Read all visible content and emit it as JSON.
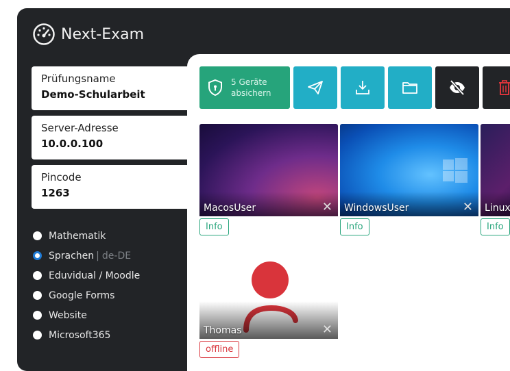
{
  "app": {
    "title": "Next-Exam"
  },
  "fields": [
    {
      "label": "Prüfungsname",
      "value": "Demo-Schularbeit"
    },
    {
      "label": "Server-Adresse",
      "value": "10.0.0.100"
    },
    {
      "label": "Pincode",
      "value": "1263"
    }
  ],
  "modes": [
    {
      "label": "Mathematik",
      "checked": false
    },
    {
      "label": "Sprachen",
      "separator": "|",
      "sub": "de-DE",
      "checked": true
    },
    {
      "label": "Eduvidual / Moodle",
      "checked": false
    },
    {
      "label": "Google Forms",
      "checked": false
    },
    {
      "label": "Website",
      "checked": false
    },
    {
      "label": "Microsoft365",
      "checked": false
    }
  ],
  "toolbar": {
    "secure_line1": "5 Geräte",
    "secure_line2": "absichern",
    "icons": [
      "shield-icon",
      "send-icon",
      "download-icon",
      "folder-icon",
      "eye-off-icon",
      "trash-icon"
    ]
  },
  "students": [
    {
      "name": "MacosUser",
      "status": "Info"
    },
    {
      "name": "WindowsUser",
      "status": "Info"
    },
    {
      "name": "Linux",
      "status": "Info"
    },
    {
      "name": "Thomas",
      "status": "offline"
    }
  ],
  "colors": {
    "accent_green": "#26a47b",
    "accent_teal": "#22aec6",
    "danger": "#d9343b",
    "dark": "#222427"
  }
}
